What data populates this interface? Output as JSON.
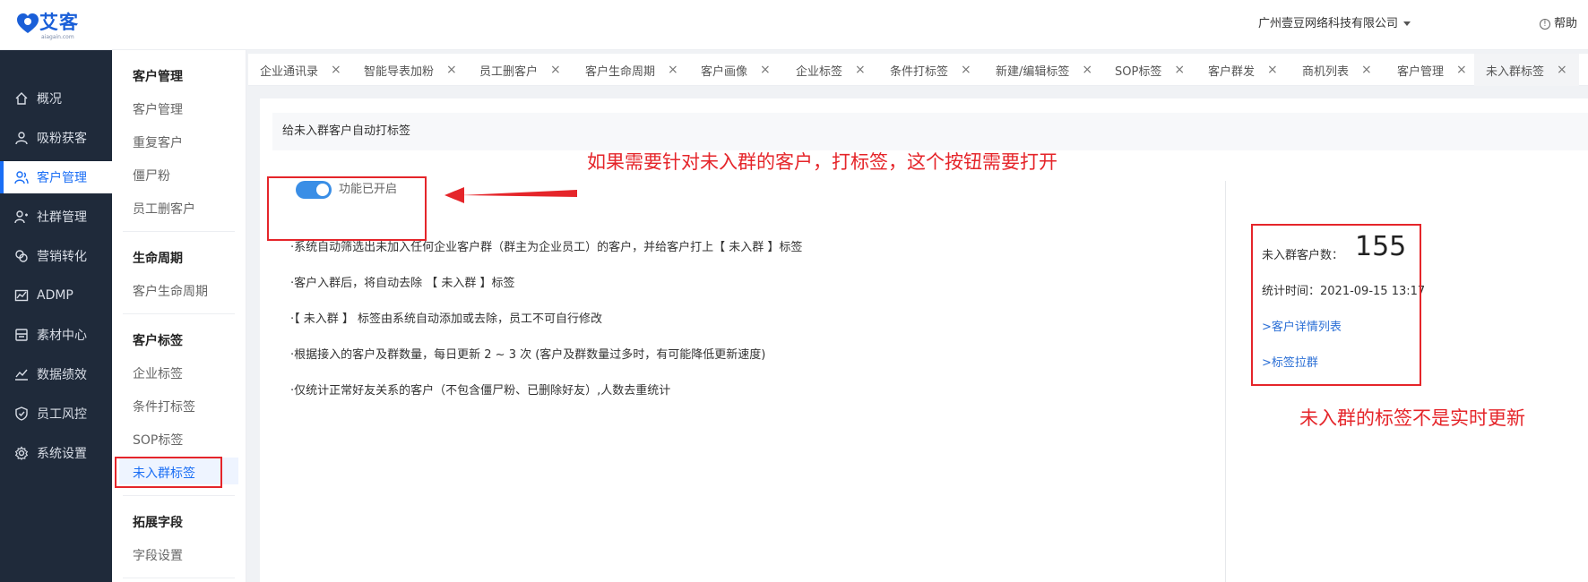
{
  "brand": {
    "name": "艾客",
    "domain": "aiagain.com",
    "accent": "#1a6ef5"
  },
  "header": {
    "company": "广州壹豆网络科技有限公司",
    "help_label": "帮助"
  },
  "left_nav": [
    {
      "label": "概况",
      "icon": "home-icon"
    },
    {
      "label": "吸粉获客",
      "icon": "user-icon"
    },
    {
      "label": "客户管理",
      "icon": "users-icon",
      "active": true
    },
    {
      "label": "社群管理",
      "icon": "group-icon"
    },
    {
      "label": "营销转化",
      "icon": "marketing-icon"
    },
    {
      "label": "ADMP",
      "icon": "chart-icon"
    },
    {
      "label": "素材中心",
      "icon": "material-icon"
    },
    {
      "label": "数据绩效",
      "icon": "trend-icon"
    },
    {
      "label": "员工风控",
      "icon": "shield-icon"
    },
    {
      "label": "系统设置",
      "icon": "gear-icon"
    }
  ],
  "sub_nav": {
    "groups": [
      {
        "title": "客户管理",
        "items": [
          "客户管理",
          "重复客户",
          "僵尸粉",
          "员工删客户"
        ]
      },
      {
        "title": "生命周期",
        "items": [
          "客户生命周期"
        ]
      },
      {
        "title": "客户标签",
        "items": [
          "企业标签",
          "条件打标签",
          "SOP标签",
          "未入群标签"
        ]
      },
      {
        "title": "拓展字段",
        "items": [
          "字段设置"
        ]
      }
    ],
    "active_item": "未入群标签"
  },
  "tabs": [
    {
      "label": "企业通讯录"
    },
    {
      "label": "智能导表加粉"
    },
    {
      "label": "员工删客户"
    },
    {
      "label": "客户生命周期"
    },
    {
      "label": "客户画像"
    },
    {
      "label": "企业标签"
    },
    {
      "label": "条件打标签"
    },
    {
      "label": "新建/编辑标签"
    },
    {
      "label": "SOP标签"
    },
    {
      "label": "客户群发"
    },
    {
      "label": "商机列表"
    },
    {
      "label": "客户管理"
    },
    {
      "label": "未入群标签",
      "active": true
    }
  ],
  "tab_close": "×",
  "content": {
    "title": "给未入群客户自动打标签",
    "toggle": {
      "on": true,
      "label": "功能已开启"
    },
    "rules": [
      "·系统自动筛选出未加入任何企业客户群（群主为企业员工）的客户，并给客户打上【 未入群 】标签",
      "·客户入群后，将自动去除 【 未入群 】标签",
      "·【 未入群 】 标签由系统自动添加或去除，员工不可自行修改",
      "·根据接入的客户及群数量，每日更新 2 ~ 3 次 (客户及群数量过多时，有可能降低更新速度)",
      "·仅统计正常好友关系的客户（不包含僵尸粉、已删除好友）,人数去重统计"
    ],
    "stats": {
      "count_label": "未入群客户数：",
      "count": "155",
      "time_label": "统计时间：",
      "time": "2021-09-15 13:17",
      "link_detail": ">客户详情列表",
      "link_pull": ">标签拉群"
    }
  },
  "annotations": {
    "note_top": "如果需要针对未入群的客户，打标签，这个按钮需要打开",
    "note_right": "未入群的标签不是实时更新",
    "color": "#e5252a"
  }
}
